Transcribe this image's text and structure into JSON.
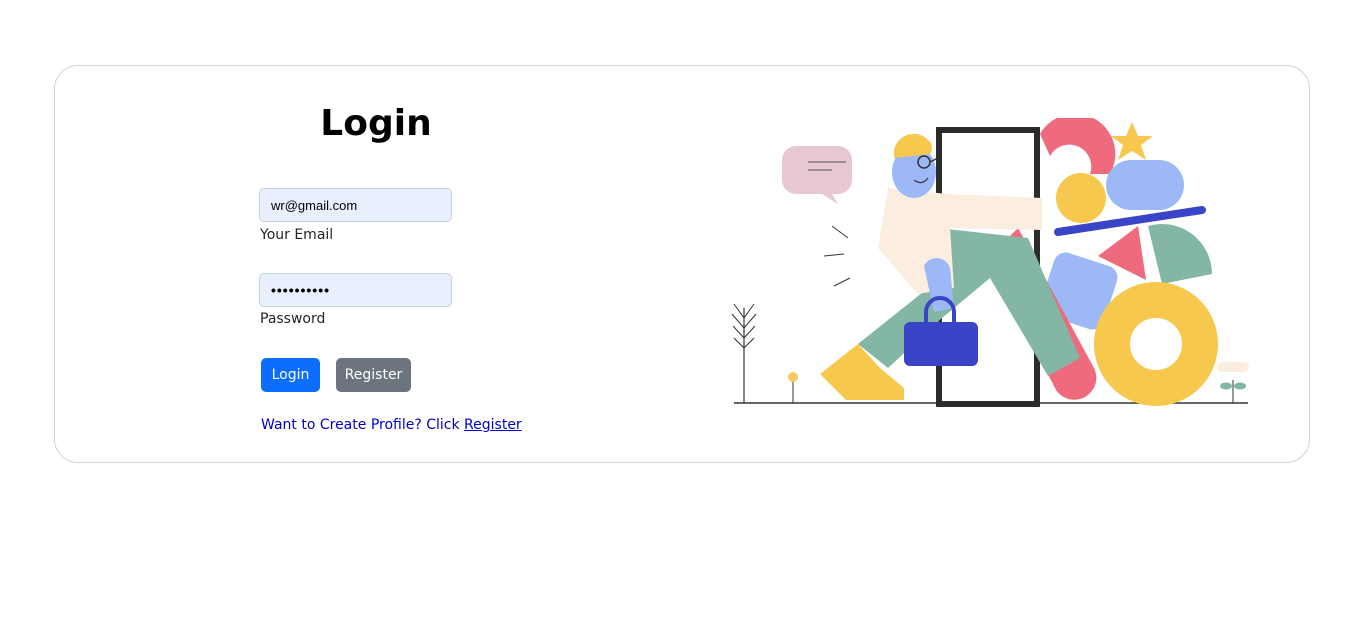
{
  "login_form": {
    "title": "Login",
    "email": {
      "value": "wr@gmail.com",
      "label": "Your Email"
    },
    "password": {
      "value": "••••••••••",
      "label": "Password"
    },
    "buttons": {
      "login_label": "Login",
      "register_label": "Register"
    },
    "prompt": {
      "text": "Want to Create Profile? Click ",
      "link_label": "Register"
    }
  },
  "colors": {
    "primary": "#0d6efd",
    "secondary": "#6c757d",
    "input_bg": "#e8f0fe",
    "link": "#0000cc"
  },
  "illustration": {
    "icon": "person-entering-door-illustration"
  }
}
